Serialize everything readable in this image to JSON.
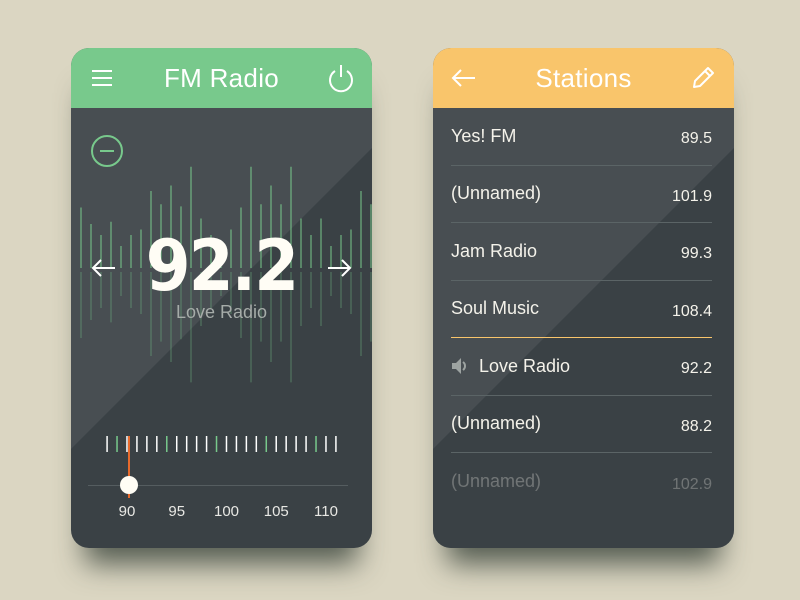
{
  "radio": {
    "title": "FM Radio",
    "menu_icon": "hamburger-menu-icon",
    "power_icon": "power-icon",
    "remove_icon": "minus-circle-icon",
    "frequency": "92.2",
    "station_name": "Love Radio",
    "prev_icon": "arrow-left-icon",
    "next_icon": "arrow-right-icon",
    "waveform_amplitudes": [
      0.55,
      0.4,
      0.3,
      0.42,
      0.2,
      0.3,
      0.35,
      0.7,
      0.58,
      0.75,
      0.56,
      0.92,
      0.45,
      0.3,
      0.2,
      0.35,
      0.55,
      0.92,
      0.58,
      0.75,
      0.58,
      0.92,
      0.45,
      0.3,
      0.45,
      0.2,
      0.3,
      0.35,
      0.7,
      0.58
    ],
    "dial": {
      "min": 88,
      "max": 112,
      "value": 92.2,
      "labels": [
        "90",
        "95",
        "100",
        "105",
        "110"
      ],
      "label_values": [
        90,
        95,
        100,
        105,
        110
      ]
    },
    "colors": {
      "accent": "#78c98c",
      "needle": "#e86a2c",
      "body": "#3a4145"
    }
  },
  "stations": {
    "title": "Stations",
    "back_icon": "arrow-left-icon",
    "edit_icon": "pencil-icon",
    "playing_icon": "speaker-icon",
    "items": [
      {
        "name": "Yes! FM",
        "freq": "89.5"
      },
      {
        "name": "(Unnamed)",
        "freq": "101.9"
      },
      {
        "name": "Jam Radio",
        "freq": "99.3"
      },
      {
        "name": "Soul Music",
        "freq": "108.4"
      },
      {
        "name": "Love Radio",
        "freq": "92.2"
      },
      {
        "name": "(Unnamed)",
        "freq": "88.2"
      },
      {
        "name": "(Unnamed)",
        "freq": "102.9"
      }
    ],
    "colors": {
      "accent": "#f9c56b"
    }
  }
}
